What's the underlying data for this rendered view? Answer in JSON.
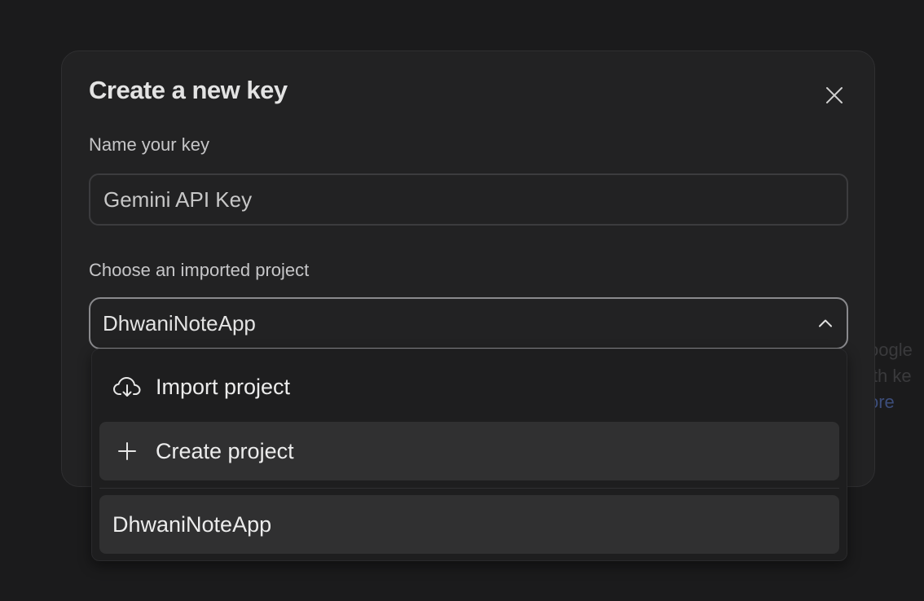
{
  "background": {
    "partial_text_line1": "oogle",
    "partial_text_line2": "ith ke",
    "partial_link": "ore"
  },
  "dialog": {
    "title": "Create a new key",
    "close_icon": "close-icon",
    "name_label": "Name your key",
    "name_value": "Gemini API Key",
    "project_label": "Choose an imported project",
    "project_selected": "DhwaniNoteApp",
    "select_icon": "chevron-up-icon"
  },
  "dropdown": {
    "import_label": "Import project",
    "import_icon": "cloud-download-icon",
    "create_label": "Create project",
    "create_icon": "plus-icon",
    "projects": [
      {
        "label": "DhwaniNoteApp"
      }
    ]
  },
  "colors": {
    "background": "#1b1b1c",
    "dialog": "#222223",
    "dropdown": "#1e1e1f",
    "highlight": "#303031",
    "text": "#e3e3e3"
  }
}
